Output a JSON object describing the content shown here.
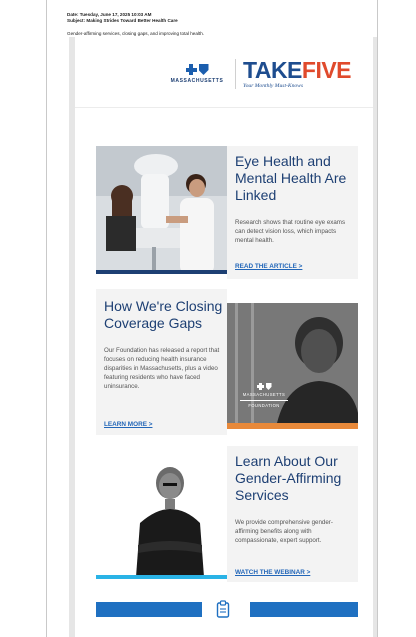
{
  "email_header": {
    "date": "Date: Tuesday, June 17, 2025 10:03 AM",
    "subject": "Subject: Making Strides Toward Better Health Care",
    "preview": "Gender-affirming services, closing gaps, and improving total health."
  },
  "logos": {
    "bcbs_state": "MASSACHUSETTS",
    "takefive_take": "TAKE",
    "takefive_five": "FIVE",
    "takefive_tagline": "Your Monthly Must-Knows",
    "icon_names": [
      "blue-cross-icon",
      "blue-shield-icon"
    ]
  },
  "articles": [
    {
      "title": "Eye Health and Mental Health Are Linked",
      "body": "Research shows that routine eye exams can detect vision loss, which impacts mental health.",
      "link": "READ THE ARTICLE >"
    },
    {
      "title": "How We're Closing Coverage Gaps",
      "body": "Our Foundation has released a report that focuses on reducing health insurance disparities in Massachusetts, plus a video featuring residents who have faced uninsurance.",
      "link": "LEARN MORE >",
      "image_logo_state": "MASSACHUSETTS",
      "image_logo_label": "FOUNDATION"
    },
    {
      "title": "Learn About Our Gender-Affirming Services",
      "body": "We provide comprehensive gender-affirming benefits along with compassionate, expert support.",
      "link": "WATCH THE WEBINAR >"
    }
  ],
  "footer": {
    "center_icon": "clipboard-icon"
  },
  "colors": {
    "brand_blue": "#1d3f73",
    "link_blue": "#2266b8",
    "accent_orange": "#e8893a",
    "accent_cyan": "#2ab3e6",
    "button_blue": "#1f70c1",
    "takefive_red": "#e04a2c"
  }
}
